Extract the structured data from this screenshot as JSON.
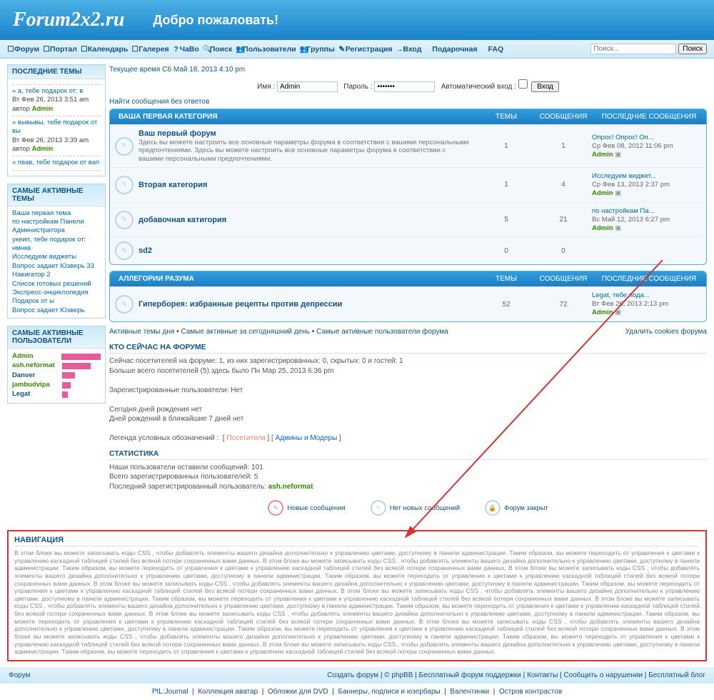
{
  "header": {
    "logo": "Forum2x2.ru",
    "welcome": "Добро пожаловать!"
  },
  "nav": {
    "items": [
      {
        "ico": "☐",
        "label": "Форум"
      },
      {
        "ico": "☐",
        "label": "Портал"
      },
      {
        "ico": "☐",
        "label": "Календарь"
      },
      {
        "ico": "☐",
        "label": "Галерея"
      },
      {
        "ico": "?",
        "label": "ЧаВо"
      },
      {
        "ico": "🔍",
        "label": "Поиск"
      },
      {
        "ico": "👥",
        "label": "Пользователи"
      },
      {
        "ico": "👥",
        "label": "Группы"
      },
      {
        "ico": "✎",
        "label": "Регистрация"
      },
      {
        "ico": "→",
        "label": "Вход"
      },
      {
        "ico": "",
        "label": "Подарочная"
      },
      {
        "ico": "",
        "label": "FAQ"
      }
    ],
    "search_ph": "Поиск...",
    "search_btn": "Поиск"
  },
  "sidebar": {
    "latest": {
      "title": "ПОСЛЕДНИЕ ТЕМЫ",
      "items": [
        {
          "line": "» а, тебе подарок от: в",
          "meta": "Вт Фев 26, 2013 3:51 am",
          "by": "автор ",
          "user": "Admin",
          "link": 1
        },
        {
          "line": "» вывывы, тебе подарок от вы",
          "meta": "Вт Фев 26, 2013 3:39 am",
          "by": "автор ",
          "user": "Admin",
          "link": 1
        },
        {
          "line": "» пвав, тебе подарок от вап",
          "meta": "",
          "by": "",
          "user": "",
          "link": 1
        }
      ]
    },
    "active_topics": {
      "title": "САМЫЕ АКТИВНЫЕ ТЕМЫ",
      "items": [
        "Ваша первая тема",
        "по настройкам Панели Администратора",
        "укеип, тебе подарок от: нмнкв",
        "Исследуем виджеты",
        "Вопрос задает Юзверь 33",
        "Навигатор 2",
        "Список готовых решений",
        "Экспресс-энциклопедия",
        "Подарок от ы",
        "Вопрос задает Юзверь"
      ]
    },
    "active_users": {
      "title": "САМЫЕ АКТИВНЫЕ ПОЛЬЗОВАТЕЛИ",
      "items": [
        {
          "name": "Admin",
          "w": 55,
          "c": "#368a00"
        },
        {
          "name": "ash.neformat",
          "w": 40,
          "c": "#368a00"
        },
        {
          "name": "Danver",
          "w": 18,
          "c": "#105289"
        },
        {
          "name": "jambudvipa",
          "w": 12,
          "c": "#368a00"
        },
        {
          "name": "Legat",
          "w": 8,
          "c": "#105289"
        }
      ]
    }
  },
  "main": {
    "curr_time": "Текущее время Сб Май 18, 2013 4:10 pm",
    "login": {
      "name_lbl": "Имя :",
      "name_val": "Admin",
      "pass_lbl": "Пароль :",
      "pass_val": "•••••••",
      "auto": "Автоматический вход :",
      "btn": "Вход"
    },
    "find": "Найти сообщения без ответов",
    "cols": {
      "topics": "ТЕМЫ",
      "posts": "СООБЩЕНИЯ",
      "last": "ПОСЛЕДНИЕ СООБЩЕНИЯ"
    },
    "cats": [
      {
        "title": "ВАША ПЕРВАЯ КАТЕГОРИЯ",
        "forums": [
          {
            "name": "Ваш первый форум",
            "desc": "Здесь вы можете настроить все основные параметры форума в соответствии с вашими персональными предпочтениями. Здесь вы можете настроить все основные параметры форума в соответствии с вашими персональными предпочтениями.",
            "t": "1",
            "p": "1",
            "last": {
              "topic": "Опрос! Опрос! Оп...",
              "date": "Ср Фев 08, 2012 11:06 pm",
              "user": "Admin"
            }
          },
          {
            "name": "Вторая категория",
            "desc": "",
            "t": "1",
            "p": "4",
            "last": {
              "topic": "Исследуем виджет...",
              "date": "Ср Фев 13, 2013 2:37 pm",
              "user": "Admin"
            }
          },
          {
            "name": "добавочная катигория",
            "desc": "",
            "t": "5",
            "p": "21",
            "last": {
              "topic": "по настройкам Па...",
              "date": "Вс Май 12, 2013 6:27 pm",
              "user": "Admin"
            }
          },
          {
            "name": "sd2",
            "desc": "",
            "t": "0",
            "p": "0",
            "last": {
              "topic": "",
              "date": "",
              "user": ""
            }
          }
        ]
      },
      {
        "title": "АЛЛЕГОРИИ РАЗУМА",
        "forums": [
          {
            "name": "Гиперборея: избранные рецепты против депрессии",
            "desc": "",
            "t": "52",
            "p": "72",
            "last": {
              "topic": "Legat, тебе пода...",
              "date": "Вт Фев 26, 2013 2:13 pm",
              "user": "Admin"
            }
          }
        ]
      }
    ],
    "quick": {
      "l1": "Активные темы дня",
      "l2": "Самые активные за сегодняшний день",
      "l3": "Самые активные пользователи форума",
      "r": "Удалить cookies форума"
    },
    "who": {
      "title": "КТО СЕЙЧАС НА ФОРУМЕ",
      "l1": "Сейчас посетителей на форуме: 1, из них зарегистрированных: 0, скрытых: 0 и гостей: 1",
      "l2": "Больше всего посетителей (5) здесь было Пн Мар 25, 2013 6:36 pm",
      "l3": "Зарегистрированные пользователи: Нет",
      "l4": "Сегодня дней рождения нет",
      "l5": "Дней рождений в ближайшие 7 дней нет",
      "legend": "Легенда условных обозначений :",
      "g1": "Посетители",
      "g2": "Админы и Модеры"
    },
    "stats": {
      "title": "СТАТИСТИКА",
      "l1": "Наши пользователи оставили сообщений: 101",
      "l2": "Всего зарегистрированных пользователей: 5",
      "l3": "Последний зарегистрированный пользователь: ",
      "user": "ash.neformat"
    },
    "legend": {
      "a": "Новые сообщения",
      "b": "Нет новых сообщений",
      "c": "Форум закрыт"
    }
  },
  "navblock": {
    "title": "НАВИГАЦИЯ",
    "text": "В этом блоке вы можете записывать коды CSS , чтобы добавлять элементы вашего дизайна дополнительно к управлению цветами, доступному в панели администрации. Таким образом, вы можете переходить от управления к цветами к управлению каскадной таблицей стилей без всякой потери сохраненных вами данных. В этом блоке вы можете записывать коды CSS , чтобы добавлять элементы вашего дизайна дополнительно к управлению цветами, доступному в панели администрации. Таким образом, вы можете переходить от управления к цветами к управлению каскадной таблицей стилей без всякой потери сохраненных вами данных. В этом блоке вы можете записывать коды CSS , чтобы добавлять элементы вашего дизайна дополнительно к управлению цветами, доступному в панели администрации. Таким образом, вы можете переходить от управления к цветами к управлению каскадной таблицей стилей без всякой потери сохраненных вами данных. В этом блоке вы можете записывать коды CSS , чтобы добавлять элементы вашего дизайна дополнительно к управлению цветами, доступному в панели администрации. Таким образом, вы можете переходить от управления к цветами к управлению каскадной таблицей стилей без всякой потери сохраненных вами данных. В этом блоке вы можете записывать коды CSS , чтобы добавлять элементы вашего дизайна дополнительно к управлению цветами, доступному в панели администрации. Таким образом, вы можете переходить от управления к цветами к управлению каскадной таблицей стилей без всякой потери сохраненных вами данных. В этом блоке вы можете записывать коды CSS , чтобы добавлять элементы вашего дизайна дополнительно к управлению цветами, доступному в панели администрации. Таким образом, вы можете переходить от управления к цветами к управлению каскадной таблицей стилей без всякой потери сохраненных вами данных. В этом блоке вы можете записывать коды CSS , чтобы добавлять элементы вашего дизайна дополнительно к управлению цветами, доступному в панели администрации. Таким образом, вы можете переходить от управления к цветами к управлению каскадной таблицей стилей без всякой потери сохраненных вами данных. В этом блоке вы можете записывать коды CSS , чтобы добавлять элементы вашего дизайна дополнительно к управлению цветами, доступному в панели администрации. Таким образом, вы можете переходить от управления к цветами к управлению каскадной таблицей стилей без всякой потери сохраненных вами данных. В этом блоке вы можете записывать коды CSS , чтобы добавлять элементы вашего дизайна дополнительно к управлению цветами, доступному в панели администрации. Таким образом, вы можете переходить от управления к цветами к управлению каскадной таблицей стилей без всякой потери сохраненных вами данных. В этом блоке вы можете записывать коды CSS , чтобы добавлять элементы вашего дизайна дополнительно к управлению цветами, доступному в панели администрации. Таким образом, вы можете переходить от управления к цветами к управлению каскадной таблицей стилей без всякой потери сохраненных вами данных."
  },
  "footer": {
    "left": "Форум",
    "right": [
      "Создать форум",
      "© phpBB",
      "Бесплатный форум поддержки",
      "Контакты",
      "Сообщить о нарушении",
      "Бесплатный блог"
    ],
    "row2": [
      "PtL:Journal",
      "Коллекция аватар",
      "Обложки для DVD",
      "Баннеры, подписи и юзербары",
      "Валентинки",
      "Остров контрастов"
    ]
  }
}
